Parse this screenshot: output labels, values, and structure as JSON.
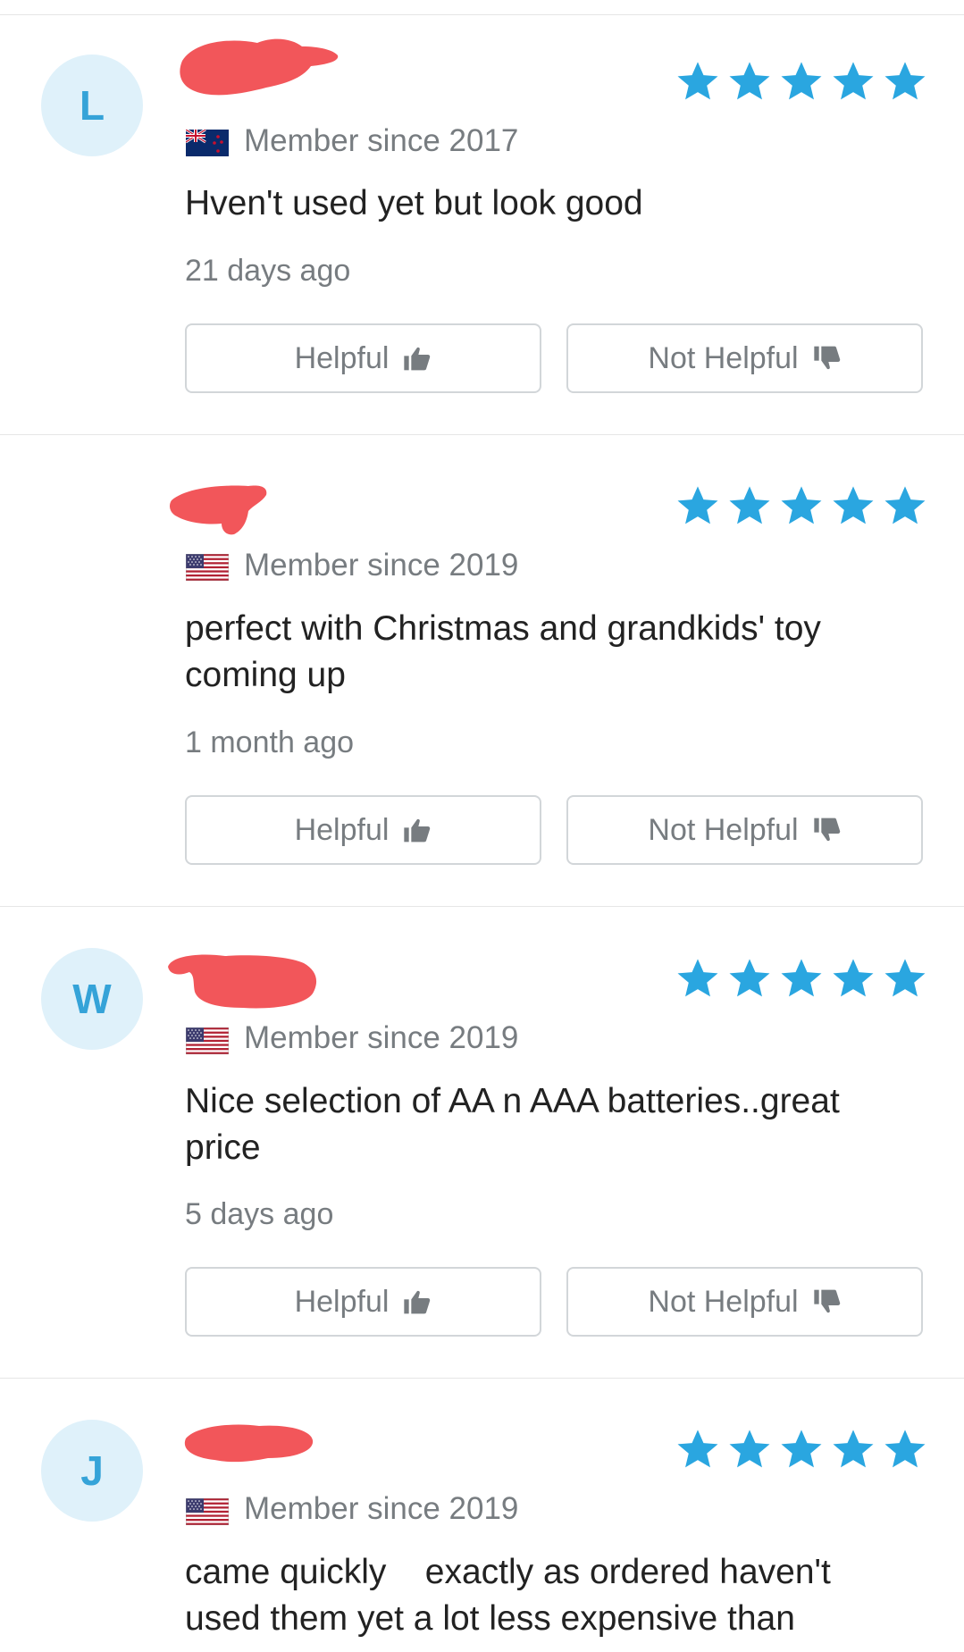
{
  "colors": {
    "star": "#2aa6e0",
    "avatar_bg": "#dff1fa",
    "avatar_text": "#35a3d8",
    "redaction": "#f2565a",
    "muted_text": "#777c80",
    "border": "#d2d6d9"
  },
  "buttons": {
    "helpful_label": "Helpful",
    "not_helpful_label": "Not Helpful",
    "helpful_icon": "thumbs-up-icon",
    "not_helpful_icon": "thumbs-down-icon"
  },
  "reviews": [
    {
      "avatar_letter": "L",
      "rating": 5,
      "flag": "new-zealand-flag-icon",
      "member_since": "Member since 2017",
      "text": "Hven't used yet but look good",
      "date": "21 days ago"
    },
    {
      "avatar_letter": "",
      "rating": 5,
      "flag": "us-flag-icon",
      "member_since": "Member since 2019",
      "text": "perfect with Christmas and grandkids' toy\ncoming up",
      "date": "1 month ago"
    },
    {
      "avatar_letter": "W",
      "rating": 5,
      "flag": "us-flag-icon",
      "member_since": "Member since 2019",
      "text": "Nice selection of AA n AAA batteries..great\nprice",
      "date": "5 days ago"
    },
    {
      "avatar_letter": "J",
      "rating": 5,
      "flag": "us-flag-icon",
      "member_since": "Member since 2019",
      "text": "came quickly    exactly as ordered haven't\nused them yet a lot less expensive than",
      "date": ""
    }
  ]
}
